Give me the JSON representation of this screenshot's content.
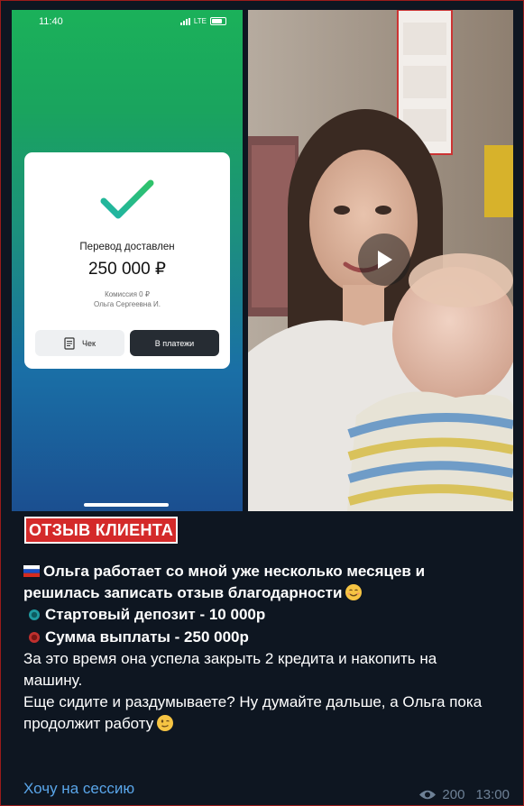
{
  "phone": {
    "time": "11:40",
    "network": "LTE",
    "title": "Перевод доставлен",
    "amount": "250 000 ₽",
    "commission": "Комиссия 0 ₽",
    "recipient": "Ольга Сергеевна И.",
    "receipt_label": "Чек",
    "payments_label": "В платежи"
  },
  "post": {
    "badge": "ОТЗЫВ КЛИЕНТА",
    "line1": "Ольга работает со мной уже несколько месяцев и",
    "line2": "решилась записать отзыв благодарности",
    "deposit": "Стартовый депозит - 10 000р",
    "payouts": "Сумма выплаты - 250 000р",
    "text1a": "За это время она успела закрыть 2 кредита и накопить на",
    "text1b": "машину.",
    "text2a": "Еще сидите и раздумываете? Ну думайте дальше, а Ольга пока",
    "text2b": "продолжит работу",
    "cta": "Хочу на сессию",
    "views": "200",
    "time": "13:00"
  },
  "icons": {
    "flag": "russia-flag-icon",
    "deposit_dot": "teal-circle-icon",
    "payout_dot": "red-circle-icon",
    "smile": "smiling-face-icon",
    "wink": "winking-face-icon",
    "views": "eye-icon",
    "play": "play-icon",
    "check": "checkmark-icon"
  },
  "colors": {
    "background": "#0e1621",
    "accent_link": "#5aa6ea",
    "badge": "#d42a2a",
    "deposit_dot": "#1f9aa0",
    "payout_dot": "#c0302e"
  }
}
